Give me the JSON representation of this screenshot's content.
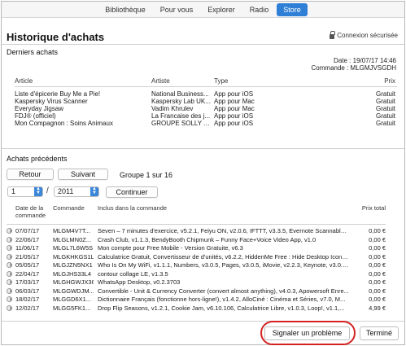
{
  "nav": {
    "tabs": [
      {
        "label": "Bibliothèque"
      },
      {
        "label": "Pour vous"
      },
      {
        "label": "Explorer"
      },
      {
        "label": "Radio"
      },
      {
        "label": "Store"
      }
    ],
    "active": "Store"
  },
  "page": {
    "title": "Historique d'achats",
    "secure_label": "Connexion sécurisée",
    "latest_label": "Derniers achats"
  },
  "order": {
    "date_label": "Date : 19/07/17 14:46",
    "order_label": "Commande : MLGMJVSGDH"
  },
  "recent": {
    "columns": {
      "article": "Article",
      "artist": "Artiste",
      "type": "Type",
      "price": "Prix"
    },
    "rows": [
      {
        "article": "Liste d'épicerie Buy Me a Pie!",
        "artist": "National Business...",
        "type": "App pour iOS",
        "price": "Gratuit"
      },
      {
        "article": "Kaspersky Virus Scanner",
        "artist": "Kaspersky Lab UK...",
        "type": "App pour Mac",
        "price": "Gratuit"
      },
      {
        "article": "Everyday Jigsaw",
        "artist": "Vadim Khrulev",
        "type": "App pour Mac",
        "price": "Gratuit"
      },
      {
        "article": "FDJ® (officiel)",
        "artist": "La Francaise des j...",
        "type": "App pour iOS",
        "price": "Gratuit"
      },
      {
        "article": "Mon Compagnon : Soins Animaux",
        "artist": "GROUPE SOLLY A...",
        "type": "App pour iOS",
        "price": "Gratuit"
      }
    ]
  },
  "previous": {
    "label": "Achats précédents",
    "back_label": "Retour",
    "next_label": "Suivant",
    "group_text": "Groupe 1 sur 16",
    "month_value": "1",
    "year_value": "2011",
    "slash": "/",
    "continue_label": "Continuer"
  },
  "history": {
    "columns": {
      "date": "Date de la commande",
      "order": "Commande",
      "included": "Inclus dans la commande",
      "total": "Prix total"
    },
    "rows": [
      {
        "date": "07/07/17",
        "order": "MLGM4V7T...",
        "included": "Seven – 7 minutes d'exercice, v5.2.1, Feiyu ON, v2.0.6, IFTTT, v3.3.5, Evernote Scannable,...",
        "total": "0,00 €"
      },
      {
        "date": "22/06/17",
        "order": "MLGLMN0Z...",
        "included": "Crash Club, v1.1.3, BendyBooth Chipmunk – Funny Face+Voice Video App, v1.0",
        "total": "0,00 €"
      },
      {
        "date": "11/06/17",
        "order": "MLGL7L6W5S",
        "included": "Mon compte pour Free Mobile - Version Gratuite, v6.3",
        "total": "0,00 €"
      },
      {
        "date": "21/05/17",
        "order": "MLGKHKGS1L",
        "included": "Calculatrice Gratuit, Convertisseur de d'unités, v6.2.2, HiddenMe Free : Hide Desktop Icons,...",
        "total": "0,00 €"
      },
      {
        "date": "05/05/17",
        "order": "MLGJZN5NX1",
        "included": "Who Is On My WiFi, v1.1.1, Numbers, v3.0.5, Pages, v3.0.5, iMovie, v2.2.3, Keynote, v3.0.5,...",
        "total": "0,00 €"
      },
      {
        "date": "22/04/17",
        "order": "MLGJHS33L4",
        "included": "contour collage LE, v1.3.5",
        "total": "0,00 €"
      },
      {
        "date": "17/03/17",
        "order": "MLGHGWJX36",
        "included": "WhatsApp Desktop, v0.2.3703",
        "total": "0,00 €"
      },
      {
        "date": "06/03/17",
        "order": "MLGGWDJM...",
        "included": "Convertible - Unit & Currency Converter (convert almost anything), v4.0.3, Apowersoft Enre...",
        "total": "0,00 €"
      },
      {
        "date": "18/02/17",
        "order": "MLGGD6X1...",
        "included": "Dictionnaire Français (fonctionne hors-ligne!), v1.4.2, AlloCiné : Cinéma et Séries, v7.0, M...",
        "total": "0,00 €"
      },
      {
        "date": "12/02/17",
        "order": "MLGG5FK1...",
        "included": "Drop Flip Seasons, v1.2.1, Cookie Jam, v6.10.106, Calculatrice Libre, v1.0.3, Loop!, v1.1,...",
        "total": "4,99 €"
      }
    ]
  },
  "footer": {
    "report_label": "Signaler un problème",
    "done_label": "Terminé"
  },
  "colors": {
    "accent": "#2f7fd6",
    "highlight": "#d42222"
  }
}
